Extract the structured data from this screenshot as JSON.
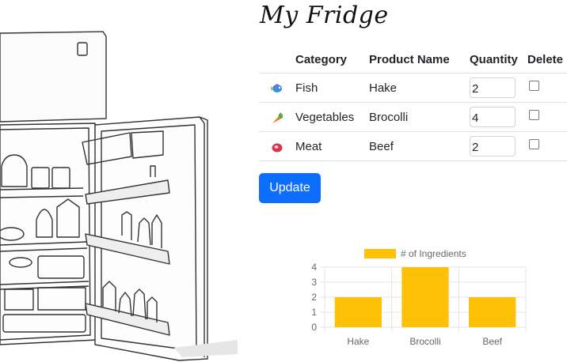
{
  "title": "My Fridge",
  "table": {
    "headers": {
      "category": "Category",
      "product": "Product Name",
      "quantity": "Quantity",
      "delete": "Delete"
    },
    "rows": [
      {
        "icon": "fish-icon",
        "category": "Fish",
        "product": "Hake",
        "quantity": "2",
        "delete": false
      },
      {
        "icon": "carrot-icon",
        "category": "Vegetables",
        "product": "Brocolli",
        "quantity": "4",
        "delete": false
      },
      {
        "icon": "meat-icon",
        "category": "Meat",
        "product": "Beef",
        "quantity": "2",
        "delete": false
      }
    ]
  },
  "update_label": "Update",
  "colors": {
    "primary": "#0d6efd",
    "bar": "#ffc107"
  },
  "chart_data": {
    "type": "bar",
    "categories": [
      "Hake",
      "Brocolli",
      "Beef"
    ],
    "series": [
      {
        "name": "# of Ingredients",
        "values": [
          2,
          4,
          2
        ]
      }
    ],
    "ylim": [
      0,
      4
    ],
    "yticks": [
      "0",
      "1",
      "2",
      "3",
      "4"
    ],
    "legend": "top",
    "grid": true
  }
}
